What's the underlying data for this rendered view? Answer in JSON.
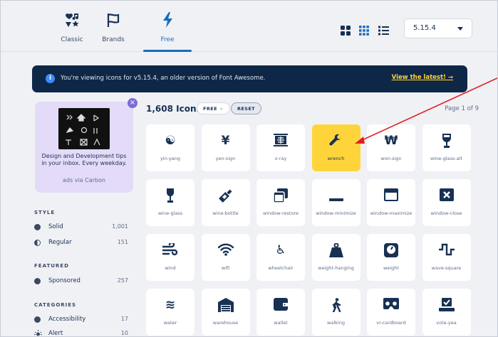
{
  "nav": {
    "tabs": [
      {
        "label": "Classic",
        "icon": "icons-icon"
      },
      {
        "label": "Brands",
        "icon": "flag-icon"
      },
      {
        "label": "Free",
        "icon": "bolt-icon",
        "active": true
      }
    ],
    "view_buttons": [
      "large-grid-icon",
      "small-grid-icon",
      "list-icon"
    ],
    "version": "5.15.4"
  },
  "banner": {
    "message": "You're viewing icons for v5.15.4, an older version of Font Awesome.",
    "cta": "View the latest!  →"
  },
  "ad": {
    "text": "Design and Development tips in your inbox. Every weekday.",
    "via": "ads via Carbon"
  },
  "sidebar": {
    "style_title": "STYLE",
    "styles": [
      {
        "name": "Solid",
        "count": "1,001"
      },
      {
        "name": "Regular",
        "count": "151"
      }
    ],
    "featured_title": "FEATURED",
    "featured": [
      {
        "name": "Sponsored",
        "count": "257"
      }
    ],
    "categories_title": "CATEGORIES",
    "categories": [
      {
        "name": "Accessibility",
        "count": "17"
      },
      {
        "name": "Alert",
        "count": "10"
      }
    ]
  },
  "results": {
    "title": "1,608 Icons",
    "chip_free": "FREE",
    "chip_free_x": "×",
    "chip_reset": "RESET",
    "page": "Page 1 of 9"
  },
  "icons": [
    {
      "name": "yin-yang",
      "icon": "yin-yang-icon",
      "glyph": "☯"
    },
    {
      "name": "yen-sign",
      "icon": "yen-sign-icon",
      "glyph": "¥"
    },
    {
      "name": "x-ray",
      "icon": "x-ray-icon",
      "glyph": ""
    },
    {
      "name": "wrench",
      "icon": "wrench-icon",
      "glyph": "",
      "selected": true
    },
    {
      "name": "won-sign",
      "icon": "won-sign-icon",
      "glyph": "₩"
    },
    {
      "name": "wine-glass-alt",
      "icon": "wine-glass-alt-icon",
      "glyph": ""
    },
    {
      "name": "wine-glass",
      "icon": "wine-glass-icon",
      "glyph": ""
    },
    {
      "name": "wine-bottle",
      "icon": "wine-bottle-icon",
      "glyph": ""
    },
    {
      "name": "window-restore",
      "icon": "window-restore-icon",
      "glyph": ""
    },
    {
      "name": "window-minimize",
      "icon": "window-minimize-icon",
      "glyph": ""
    },
    {
      "name": "window-maximize",
      "icon": "window-maximize-icon",
      "glyph": ""
    },
    {
      "name": "window-close",
      "icon": "window-close-icon",
      "glyph": ""
    },
    {
      "name": "wind",
      "icon": "wind-icon",
      "glyph": ""
    },
    {
      "name": "wifi",
      "icon": "wifi-icon",
      "glyph": ""
    },
    {
      "name": "wheelchair",
      "icon": "wheelchair-icon",
      "glyph": "♿"
    },
    {
      "name": "weight-hanging",
      "icon": "weight-hanging-icon",
      "glyph": ""
    },
    {
      "name": "weight",
      "icon": "weight-icon",
      "glyph": ""
    },
    {
      "name": "wave-square",
      "icon": "wave-square-icon",
      "glyph": ""
    },
    {
      "name": "water",
      "icon": "water-icon",
      "glyph": "≋"
    },
    {
      "name": "warehouse",
      "icon": "warehouse-icon",
      "glyph": ""
    },
    {
      "name": "wallet",
      "icon": "wallet-icon",
      "glyph": ""
    },
    {
      "name": "walking",
      "icon": "walking-icon",
      "glyph": ""
    },
    {
      "name": "vr-cardboard",
      "icon": "vr-cardboard-icon",
      "glyph": ""
    },
    {
      "name": "vote-yea",
      "icon": "vote-yea-icon",
      "glyph": ""
    }
  ],
  "colors": {
    "navy": "#183153",
    "accent_blue": "#146ebe",
    "highlight_yellow": "#ffd43b",
    "banner_bg": "#0f2746",
    "ad_bg": "#e3dbf7",
    "annotation_red": "#e02020"
  }
}
